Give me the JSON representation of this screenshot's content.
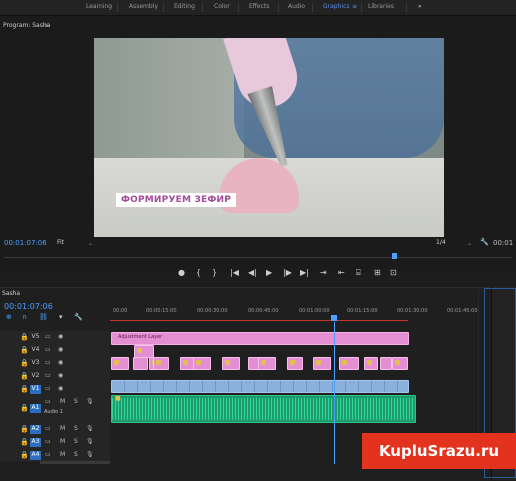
{
  "workspaces": {
    "items": [
      "Learning",
      "Assembly",
      "Editing",
      "Color",
      "Effects",
      "Audio",
      "Graphics",
      "Libraries"
    ],
    "active": "Graphics",
    "overflow": "»"
  },
  "program_monitor": {
    "title": "Program: Sasha",
    "menu": "≡",
    "video_caption": "ФОРМИРУЕМ ЗЕФИР",
    "timecode_current": "00:01:07:06",
    "fit": "Fit",
    "resolution": "1/4",
    "timecode_right": "00:01"
  },
  "transport": {
    "add_marker": "●",
    "mark_in": "{",
    "mark_out": "}",
    "go_to_in": "|◀",
    "step_back": "◀|",
    "play": "▶",
    "step_forward": "|▶",
    "go_to_out": "▶|",
    "insert": "⇥",
    "overwrite": "⇤",
    "export_frame": "⌸",
    "button_a": "⊞",
    "button_b": "⊡"
  },
  "timeline": {
    "title": "Sasha",
    "timecode": "00:01:07:06",
    "ruler_labels": [
      "00:00",
      "00:00:15:00",
      "00:00:30:00",
      "00:00:45:00",
      "00:01:00:00",
      "00:01:15:00",
      "00:01:30:00",
      "00:01:45:00"
    ],
    "tracks": [
      {
        "name": "V5",
        "selected": false
      },
      {
        "name": "V4",
        "selected": false
      },
      {
        "name": "V3",
        "selected": false
      },
      {
        "name": "V2",
        "selected": false
      },
      {
        "name": "V1",
        "selected": true
      },
      {
        "name": "A1",
        "selected": true
      },
      {
        "name": "A2",
        "selected": true
      },
      {
        "name": "A3",
        "selected": true
      },
      {
        "name": "A4",
        "selected": true
      }
    ],
    "audio_track_label": "Audio 1",
    "adjustment_layer_label": "Adjustment Layer",
    "mute": "M",
    "solo": "S"
  },
  "watermark": "KupluSrazu.ru"
}
